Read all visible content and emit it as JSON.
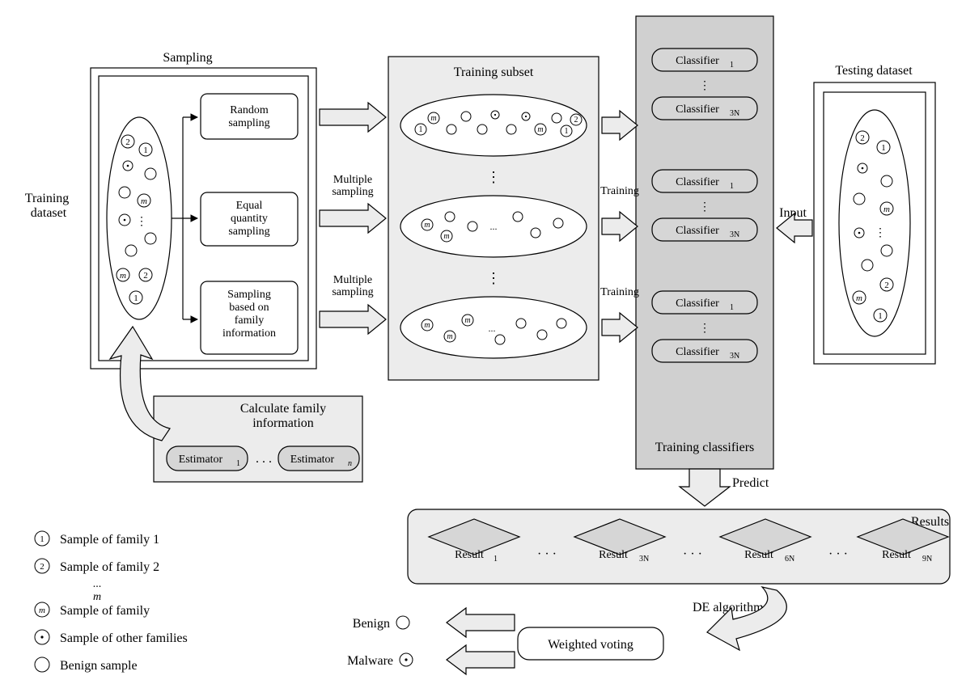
{
  "labels": {
    "sampling": "Sampling",
    "trainingDataset": "Training\ndataset",
    "random": "Random\nsampling",
    "equal": "Equal\nquantity\nsampling",
    "family": "Sampling\nbased on\nfamily\ninformation",
    "multiple": "Multiple\nsampling",
    "trainingSubset": "Training subset",
    "training": "Training",
    "testingDataset": "Testing dataset",
    "input": "Input",
    "trainingClassifiers": "Training classifiers",
    "predict": "Predict",
    "results": "Results",
    "de": "DE algorithm",
    "weighted": "Weighted voting",
    "benign": "Benign",
    "malware": "Malware",
    "calcFamily": "Calculate family\ninformation",
    "classifier1": "Classifier",
    "classifier3N": "Classifier",
    "classifierSub1": "1",
    "classifierSub3N": "3N",
    "estimator": "Estimator",
    "estSub1": "1",
    "estSubN": "n",
    "result": "Result",
    "resSub1": "1",
    "resSub3N": "3N",
    "resSub6N": "6N",
    "resSub9N": "9N"
  },
  "legend": {
    "l1": "Sample of family 1",
    "l2": "Sample of family 2",
    "ldots": "...",
    "lm_italic": "m",
    "lm": "Sample of family",
    "lo": "Sample of other families",
    "lb": "Benign sample"
  }
}
